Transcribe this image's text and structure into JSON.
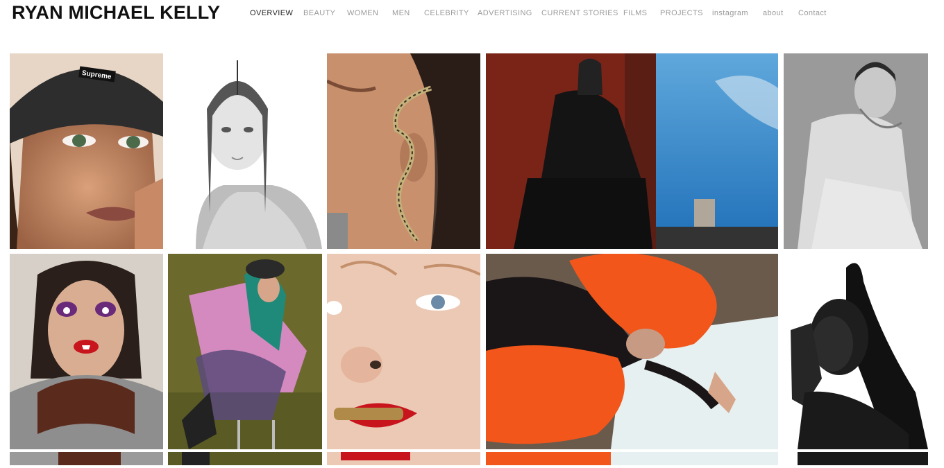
{
  "site": {
    "title": "RYAN MICHAEL KELLY"
  },
  "nav": {
    "items": [
      {
        "label": "OVERVIEW",
        "active": true
      },
      {
        "label": "BEAUTY"
      },
      {
        "label": "WOMEN"
      },
      {
        "label": "MEN"
      },
      {
        "label": "CELEBRITY"
      },
      {
        "label": "ADVERTISING"
      },
      {
        "label": "CURRENT STORIES"
      },
      {
        "label": "FILMS"
      },
      {
        "label": "PROJECTS"
      },
      {
        "label": "instagram"
      },
      {
        "label": "about"
      },
      {
        "label": "Contact"
      }
    ]
  },
  "gallery": {
    "beanie_text": "Supreme",
    "colors": {
      "accent_red": "#c8141c",
      "fur_orange": "#f2561a",
      "sky_blue": "#2e8fd4",
      "olive_bg": "#6b6a2c"
    }
  }
}
